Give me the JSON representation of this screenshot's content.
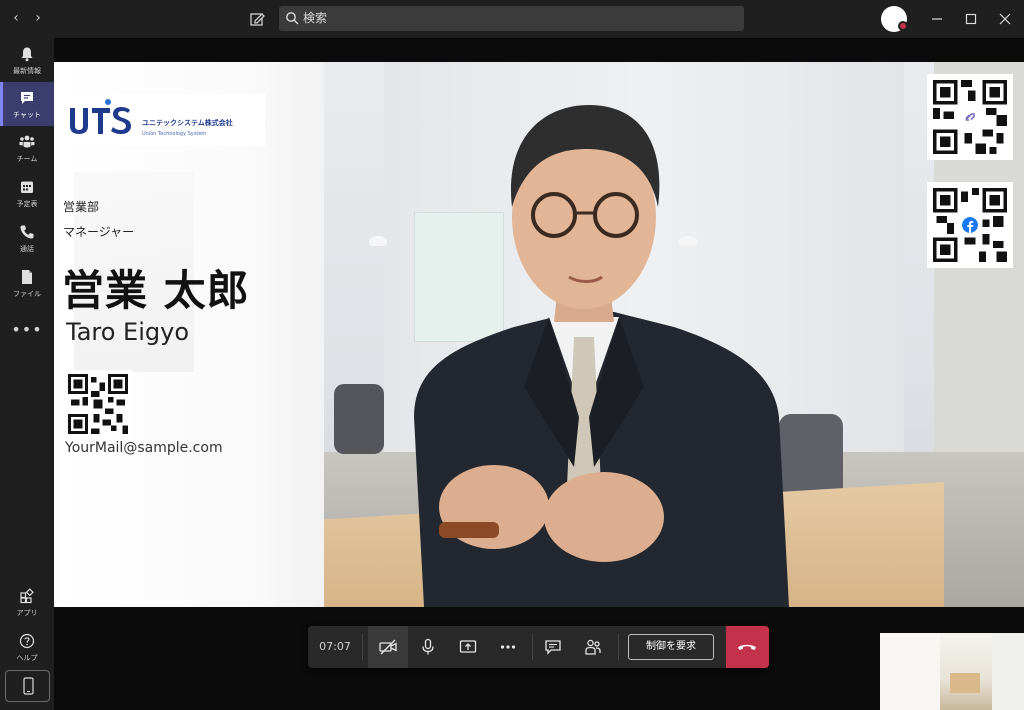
{
  "window": {
    "search_placeholder": "検索"
  },
  "rail": {
    "items": [
      {
        "label": "最新情報",
        "icon": "bell-icon"
      },
      {
        "label": "チャット",
        "icon": "chat-icon",
        "active": true
      },
      {
        "label": "チーム",
        "icon": "teams-icon"
      },
      {
        "label": "予定表",
        "icon": "calendar-icon"
      },
      {
        "label": "通話",
        "icon": "phone-icon"
      },
      {
        "label": "ファイル",
        "icon": "file-icon"
      }
    ],
    "more": "•••",
    "bottom": [
      {
        "label": "アプリ",
        "icon": "apps-icon"
      },
      {
        "label": "ヘルプ",
        "icon": "help-icon"
      }
    ]
  },
  "card": {
    "company_name": "ユニテックシステム株式会社",
    "company_en": "Union Technology System",
    "department": "営業部",
    "role": "マネージャー",
    "name_jp": "営業 太郎",
    "name_en": "Taro Eigyo",
    "email": "YourMail@sample.com"
  },
  "callbar": {
    "timer": "07:07",
    "request_control": "制御を要求"
  },
  "colors": {
    "accent": "#7f85f5",
    "hangup": "#c4314b",
    "logo_blue": "#1e3a8c"
  }
}
